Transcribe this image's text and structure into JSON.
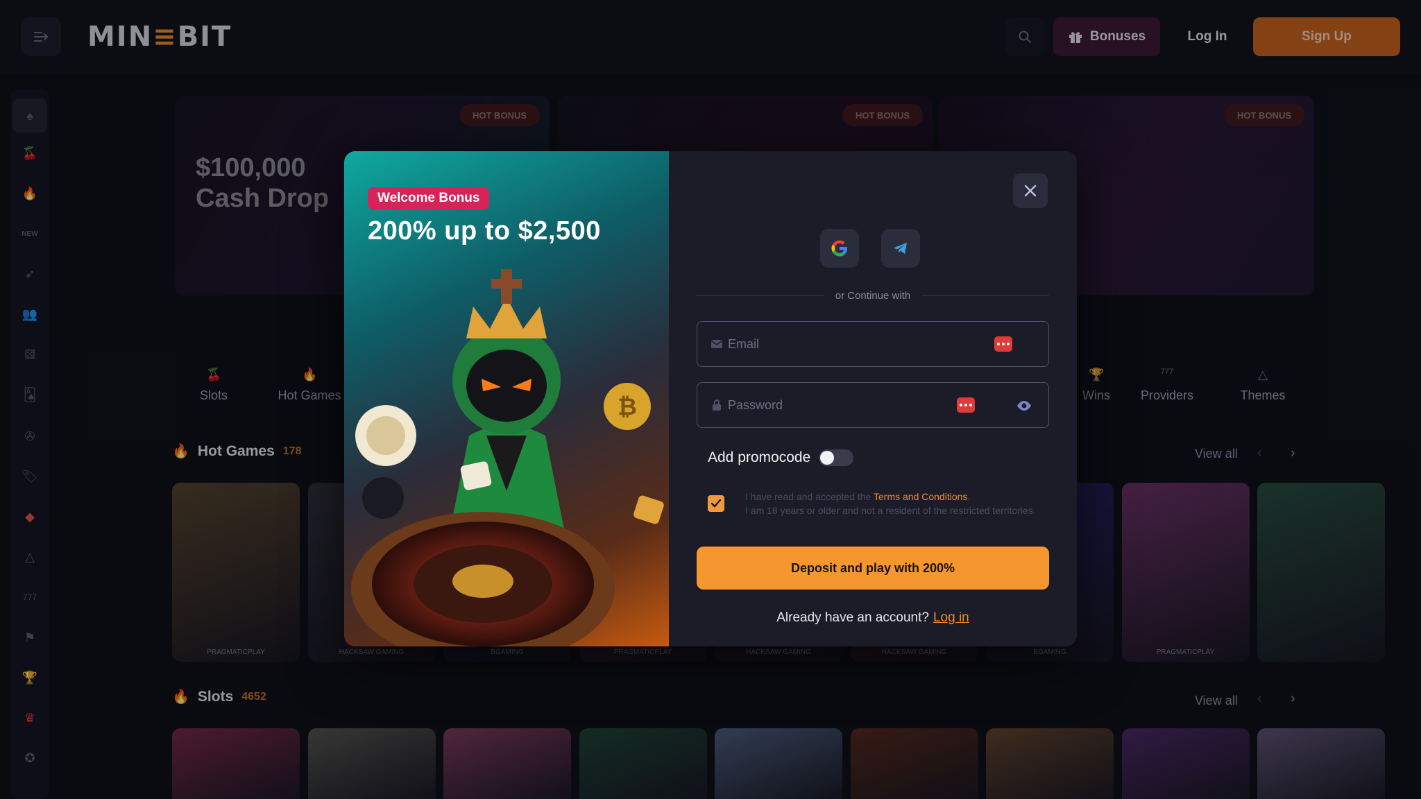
{
  "header": {
    "logo_prefix": "MIN",
    "logo_accent": "≡",
    "logo_suffix": "BIT",
    "bonuses_label": "Bonuses",
    "login_label": "Log In",
    "signup_label": "Sign Up"
  },
  "sidebar": {
    "items": [
      "spade-icon",
      "cherries-icon",
      "flame-icon",
      "new-icon",
      "rocket-icon",
      "users-icon",
      "dice-icon",
      "cards-icon",
      "roulette-icon",
      "tag-icon",
      "cube-icon",
      "shapes-icon",
      "slot-777-icon",
      "flag-icon",
      "trophy-icon",
      "crown-icon",
      "chip-icon"
    ]
  },
  "banners": [
    {
      "title_line1": "$100,000",
      "title_line2": "Cash Drop",
      "badge": "HOT BONUS"
    },
    {
      "badge": "HOT BONUS"
    },
    {
      "badge": "HOT BONUS"
    }
  ],
  "categories": [
    {
      "label": "Slots",
      "icon": "cherries-icon"
    },
    {
      "label": "Hot Games",
      "icon": "flame-icon"
    },
    {
      "label": "Wins",
      "icon": "trophy-icon"
    },
    {
      "label": "Providers",
      "icon": "slot-777-icon"
    },
    {
      "label": "Themes",
      "icon": "shapes-icon"
    }
  ],
  "sections": {
    "hot_games": {
      "title": "Hot Games",
      "count": "178",
      "view_all": "View all"
    },
    "slots": {
      "title": "Slots",
      "count": "4652",
      "view_all": "View all"
    }
  },
  "hot_games_tiles": [
    {
      "provider": "PRAGMATICPLAY",
      "color": "#8a6a3a"
    },
    {
      "provider": "HACKSAW GAMING",
      "color": "#4a4a55"
    },
    {
      "provider": "BGAMING",
      "color": "#2a3a8a"
    },
    {
      "provider": "PRAGMATICPLAY",
      "color": "#a03a6a"
    },
    {
      "provider": "HACKSAW GAMING",
      "color": "#5a2a2a"
    },
    {
      "provider": "HACKSAW GAMING",
      "color": "#8a2a2a"
    },
    {
      "provider": "BGAMING",
      "color": "#3a2aa0"
    },
    {
      "provider": "PRAGMATICPLAY",
      "color": "#b04aa0"
    },
    {
      "provider": "",
      "color": "#3a7a5a"
    }
  ],
  "slots_tiles": [
    "#c83a6a",
    "#8a8a7a",
    "#d05a8a",
    "#2a6a4a",
    "#7a9aca",
    "#8a3a1a",
    "#a06a3a",
    "#7a3aa0",
    "#9a8aba"
  ],
  "modal": {
    "welcome_badge": "Welcome Bonus",
    "headline": "200% up to $2,500",
    "divider_text": "or Continue with",
    "email_placeholder": "Email",
    "password_placeholder": "Password",
    "promocode_label": "Add promocode",
    "terms_prefix": "I have read and accepted the ",
    "terms_link": "Terms and Conditions",
    "terms_suffix": ".",
    "terms_line2": "I am 18 years or older and not a resident of the restricted territories.",
    "cta_label": "Deposit and play with 200%",
    "have_account_text": "Already have an account?",
    "login_link": "Log in",
    "social_buttons": [
      "google-icon",
      "telegram-icon"
    ]
  },
  "colors": {
    "accent": "#f08c28",
    "signup_bg": "#c8621a",
    "cta_bg": "#f5962f",
    "welcome_badge_bg": "#d8225a",
    "hot_badge_bg": "#6b1f1f"
  }
}
